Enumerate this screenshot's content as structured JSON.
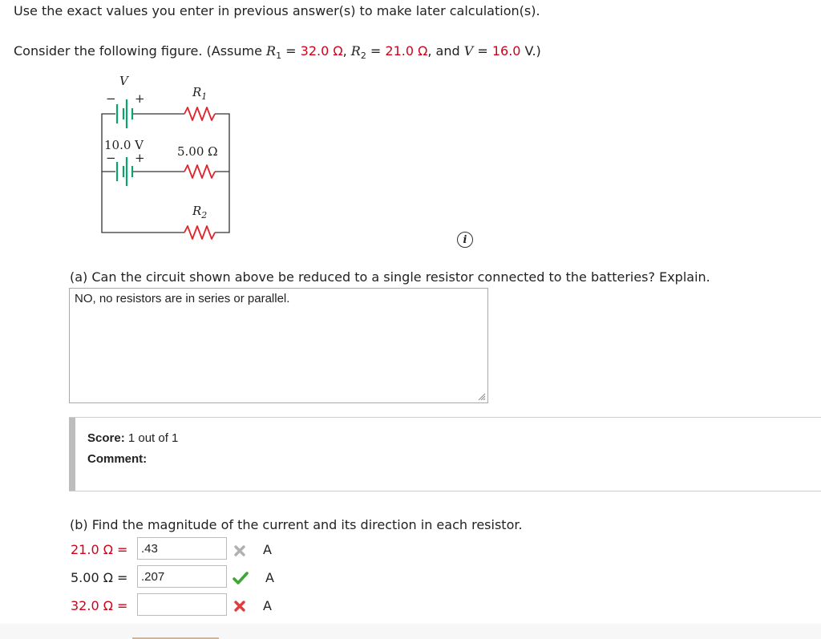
{
  "instructions": "Use the exact values you enter in previous answer(s) to make later calculation(s).",
  "problem": {
    "intro": "Consider the following figure. (Assume ",
    "r1_sym": "R",
    "r1_sub": "1",
    "eq1": " = ",
    "r1_val": "32.0 Ω",
    "sep1": ", ",
    "r2_sym": "R",
    "r2_sub": "2",
    "eq2": " = ",
    "r2_val": "21.0 Ω",
    "sep2": ", and ",
    "v_sym": "V",
    "eq3": " = ",
    "v_val": "16.0",
    "tail": " V.)"
  },
  "figure": {
    "v_label": "V",
    "minus_top": "−",
    "plus_top": "+",
    "r1_label": "R",
    "r1_sub": "1",
    "battery2_label": "10.0 V",
    "minus_mid": "−",
    "plus_mid": "+",
    "middle_resistor_label": "5.00 Ω",
    "r2_label": "R",
    "r2_sub": "2",
    "info_glyph": "i"
  },
  "part_a": {
    "question": "(a) Can the circuit shown above be reduced to a single resistor connected to the batteries? Explain.",
    "answer": "NO, no resistors are in series or parallel.",
    "score_label": "Score:",
    "score_value": " 1 out of 1",
    "comment_label": "Comment:"
  },
  "part_b": {
    "question": "(b) Find the magnitude of the current and its direction in each resistor.",
    "rows": [
      {
        "label": "21.0 Ω =",
        "value": ".43",
        "unit": "A",
        "status": "incorrect-gray"
      },
      {
        "label": "5.00 Ω =",
        "value": ".207",
        "unit": "A",
        "status": "correct"
      },
      {
        "label": "32.0 Ω =",
        "value": "",
        "unit": "A",
        "status": "incorrect"
      }
    ]
  },
  "colors": {
    "accent_red": "#d0021b",
    "resistor_red": "#e2232b",
    "battery_green": "#0aa36b",
    "check_green": "#3fa535",
    "x_gray": "#b0b0b0",
    "x_red": "#e23b3b"
  }
}
